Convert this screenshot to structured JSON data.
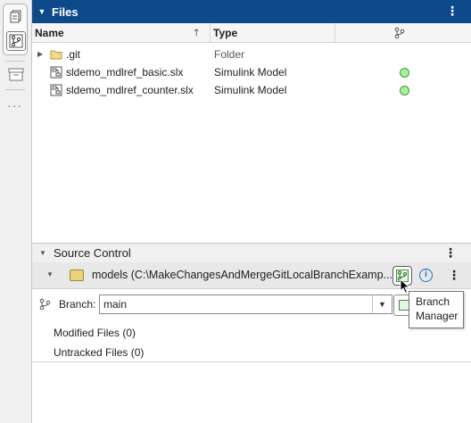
{
  "toolstrip": {
    "buttons": [
      "files-view-icon",
      "source-control-view-icon",
      "archive-icon"
    ],
    "more_label": "···"
  },
  "files": {
    "title": "Files",
    "columns": {
      "name": "Name",
      "type": "Type",
      "status_icon": "git-branch-icon"
    },
    "rows": [
      {
        "name": ".git",
        "type": "Folder",
        "icon": "folder-icon",
        "expandable": true,
        "status": ""
      },
      {
        "name": "sldemo_mdlref_basic.slx",
        "type": "Simulink Model",
        "icon": "simulink-model-icon",
        "expandable": false,
        "status": "unmodified"
      },
      {
        "name": "sldemo_mdlref_counter.slx",
        "type": "Simulink Model",
        "icon": "simulink-model-icon",
        "expandable": false,
        "status": "unmodified"
      }
    ]
  },
  "source_control": {
    "title": "Source Control",
    "repo_label": "models (C:\\MakeChangesAndMergeGitLocalBranchExamp...",
    "branch": {
      "label": "Branch:",
      "value": "main"
    },
    "items": {
      "modified": "Modified Files (0)",
      "untracked": "Untracked Files (0)"
    }
  },
  "tooltip": {
    "line1": "Branch",
    "line2": "Manager"
  },
  "colors": {
    "header_bg": "#0e4a8a",
    "status_ok": "#a7f0a0",
    "status_ok_border": "#3f9e3a",
    "info_blue": "#1e6fc5"
  }
}
